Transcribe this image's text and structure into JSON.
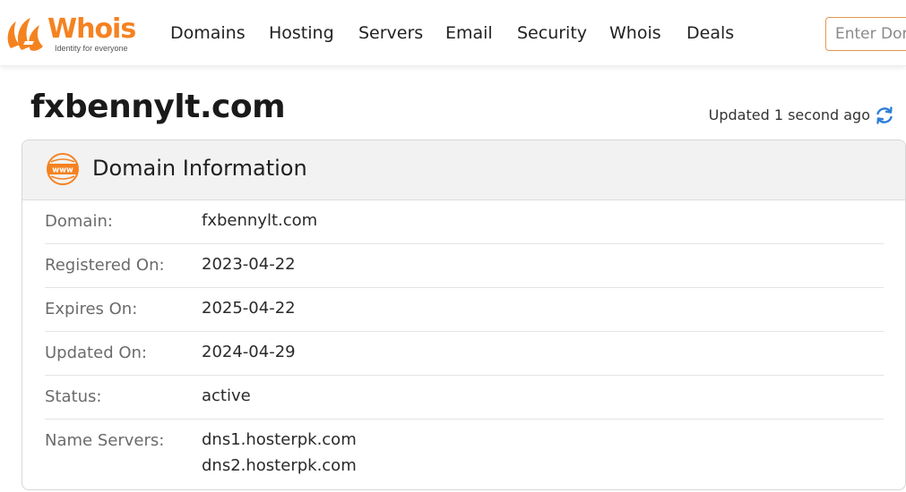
{
  "logo": {
    "name": "Whois",
    "tagline": "Identity for everyone"
  },
  "nav": {
    "items": [
      {
        "label": "Domains"
      },
      {
        "label": "Hosting"
      },
      {
        "label": "Servers"
      },
      {
        "label": "Email"
      },
      {
        "label": "Security"
      },
      {
        "label": "Whois"
      },
      {
        "label": "Deals"
      }
    ]
  },
  "search": {
    "placeholder": "Enter Domain"
  },
  "page": {
    "title": "fxbennylt.com",
    "updated_text": "Updated 1 second ago"
  },
  "card": {
    "title": "Domain Information",
    "icon": "www-icon",
    "rows": [
      {
        "label": "Domain:",
        "values": [
          "fxbennylt.com"
        ]
      },
      {
        "label": "Registered On:",
        "values": [
          "2023-04-22"
        ]
      },
      {
        "label": "Expires On:",
        "values": [
          "2025-04-22"
        ]
      },
      {
        "label": "Updated On:",
        "values": [
          "2024-04-29"
        ]
      },
      {
        "label": "Status:",
        "values": [
          "active"
        ]
      },
      {
        "label": "Name Servers:",
        "values": [
          "dns1.hosterpk.com",
          "dns2.hosterpk.com"
        ]
      }
    ]
  },
  "colors": {
    "brand": "#f58220",
    "refresh": "#2f7fd6"
  }
}
